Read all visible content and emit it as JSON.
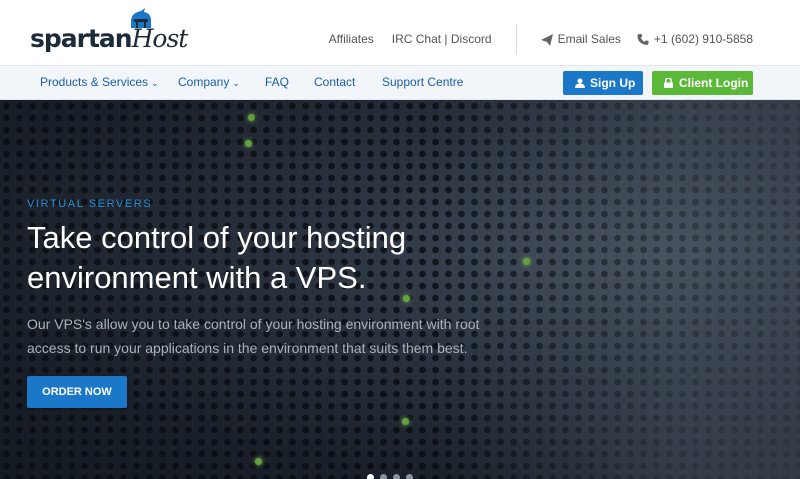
{
  "brand": {
    "logo_main": "spartan",
    "logo_accent": "Host"
  },
  "topbar": {
    "affiliates": "Affiliates",
    "irc": "IRC Chat | Discord",
    "email": "Email Sales",
    "phone": "+1 (602) 910-5858",
    "email_icon": "paper-plane-icon",
    "phone_icon": "phone-icon"
  },
  "nav": {
    "items": [
      "Products & Services",
      "Company",
      "FAQ",
      "Contact",
      "Support Centre"
    ],
    "signup": "Sign Up",
    "login": "Client Login"
  },
  "hero": {
    "eyebrow": "VIRTUAL SERVERS",
    "headline_line1": "Take control of your hosting",
    "headline_line2": "environment with a VPS.",
    "subtext": "Our VPS's allow you to take control of your hosting environment with root access to run your applications in the environment that suits them best.",
    "cta": "ORDER NOW",
    "slides": 4,
    "active_slide": 1
  },
  "colors": {
    "primary": "#1b78c8",
    "success": "#5cb838",
    "nav_link": "#1a5fa8"
  }
}
